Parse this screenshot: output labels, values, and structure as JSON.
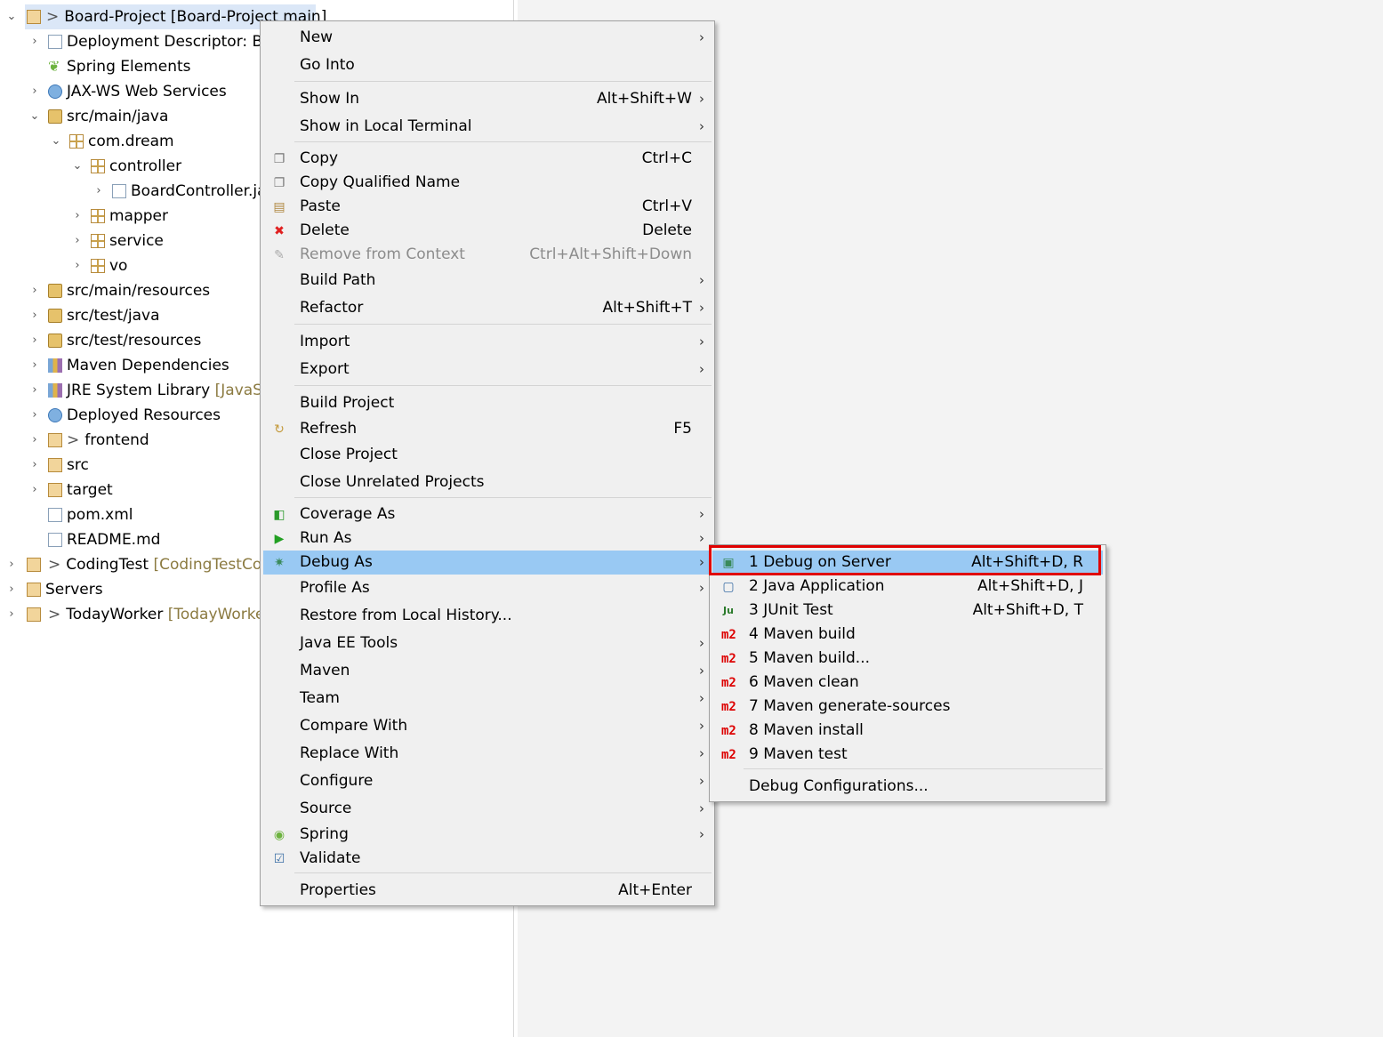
{
  "explorer": {
    "project_row": {
      "prefix": ">",
      "label": "Board-Project",
      "decoration": "[Board-Project main]"
    },
    "items": [
      "Deployment Descriptor: Bo",
      "Spring Elements",
      "JAX-WS Web Services",
      "src/main/java",
      "com.dream",
      "controller",
      "BoardController.jav",
      "mapper",
      "service",
      "vo",
      "src/main/resources",
      "src/test/java",
      "src/test/resources",
      "Maven Dependencies",
      "JRE System Library",
      "Deployed Resources",
      "frontend",
      "src",
      "target",
      "pom.xml",
      "README.md"
    ],
    "jre_decoration": "[JavaSE-",
    "frontend_prefix": ">",
    "other_projects": [
      {
        "prefix": ">",
        "label": "CodingTest",
        "decoration": "[CodingTestCou"
      },
      {
        "prefix": "",
        "label": "Servers",
        "decoration": ""
      },
      {
        "prefix": ">",
        "label": "TodayWorker",
        "decoration": "[TodayWorke"
      }
    ]
  },
  "context_menu": {
    "items": [
      {
        "label": "New",
        "shortcut": "",
        "submenu": true
      },
      {
        "label": "Go Into",
        "shortcut": ""
      },
      {
        "label": "Show In",
        "shortcut": "Alt+Shift+W",
        "submenu": true
      },
      {
        "label": "Show in Local Terminal",
        "shortcut": "",
        "submenu": true
      },
      {
        "label": "Copy",
        "shortcut": "Ctrl+C"
      },
      {
        "label": "Copy Qualified Name",
        "shortcut": ""
      },
      {
        "label": "Paste",
        "shortcut": "Ctrl+V"
      },
      {
        "label": "Delete",
        "shortcut": "Delete"
      },
      {
        "label": "Remove from Context",
        "shortcut": "Ctrl+Alt+Shift+Down",
        "disabled": true
      },
      {
        "label": "Build Path",
        "shortcut": "",
        "submenu": true
      },
      {
        "label": "Refactor",
        "shortcut": "Alt+Shift+T",
        "submenu": true
      },
      {
        "label": "Import",
        "shortcut": "",
        "submenu": true
      },
      {
        "label": "Export",
        "shortcut": "",
        "submenu": true
      },
      {
        "label": "Build Project",
        "shortcut": ""
      },
      {
        "label": "Refresh",
        "shortcut": "F5"
      },
      {
        "label": "Close Project",
        "shortcut": ""
      },
      {
        "label": "Close Unrelated Projects",
        "shortcut": ""
      },
      {
        "label": "Coverage As",
        "shortcut": "",
        "submenu": true
      },
      {
        "label": "Run As",
        "shortcut": "",
        "submenu": true
      },
      {
        "label": "Debug As",
        "shortcut": "",
        "submenu": true,
        "highlighted": true
      },
      {
        "label": "Profile As",
        "shortcut": "",
        "submenu": true
      },
      {
        "label": "Restore from Local History...",
        "shortcut": ""
      },
      {
        "label": "Java EE Tools",
        "shortcut": "",
        "submenu": true
      },
      {
        "label": "Maven",
        "shortcut": "",
        "submenu": true
      },
      {
        "label": "Team",
        "shortcut": "",
        "submenu": true
      },
      {
        "label": "Compare With",
        "shortcut": "",
        "submenu": true
      },
      {
        "label": "Replace With",
        "shortcut": "",
        "submenu": true
      },
      {
        "label": "Configure",
        "shortcut": "",
        "submenu": true
      },
      {
        "label": "Source",
        "shortcut": "",
        "submenu": true
      },
      {
        "label": "Spring",
        "shortcut": "",
        "submenu": true
      },
      {
        "label": "Validate",
        "shortcut": ""
      },
      {
        "label": "Properties",
        "shortcut": "Alt+Enter"
      }
    ],
    "arrow_glyph": "›"
  },
  "debug_submenu": {
    "items": [
      {
        "label": "1 Debug on Server",
        "shortcut": "Alt+Shift+D, R",
        "highlighted": true
      },
      {
        "label": "2 Java Application",
        "shortcut": "Alt+Shift+D, J"
      },
      {
        "label": "3 JUnit Test",
        "shortcut": "Alt+Shift+D, T"
      },
      {
        "label": "4 Maven build",
        "shortcut": ""
      },
      {
        "label": "5 Maven build...",
        "shortcut": ""
      },
      {
        "label": "6 Maven clean",
        "shortcut": ""
      },
      {
        "label": "7 Maven generate-sources",
        "shortcut": ""
      },
      {
        "label": "8 Maven install",
        "shortcut": ""
      },
      {
        "label": "9 Maven test",
        "shortcut": ""
      },
      {
        "label": "Debug Configurations...",
        "shortcut": ""
      }
    ],
    "maven_icon_text": "m2",
    "junit_icon_text": "Ju"
  },
  "colors": {
    "highlight": "#99c9f3",
    "annotation_box": "#e00000",
    "menu_bg": "#f0f0f0"
  }
}
